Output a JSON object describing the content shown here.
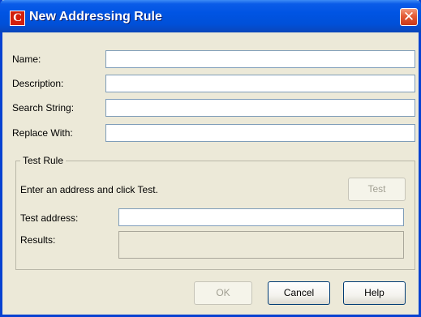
{
  "window": {
    "title": "New Addressing Rule",
    "app_icon_letter": "C",
    "close_symbol": "✕"
  },
  "form": {
    "name_label": "Name:",
    "name_value": "",
    "description_label": "Description:",
    "description_value": "",
    "search_label": "Search String:",
    "search_value": "",
    "replace_label": "Replace With:",
    "replace_value": ""
  },
  "test_rule": {
    "group_title": "Test Rule",
    "instruction": "Enter an address and click Test.",
    "test_button": "Test",
    "address_label": "Test address:",
    "address_value": "",
    "results_label": "Results:",
    "results_value": ""
  },
  "buttons": {
    "ok": "OK",
    "cancel": "Cancel",
    "help": "Help"
  },
  "colors": {
    "title_bar": "#0054e3",
    "window_bg": "#ece9d8",
    "close_button": "#e35a33",
    "app_icon": "#d2200c"
  }
}
